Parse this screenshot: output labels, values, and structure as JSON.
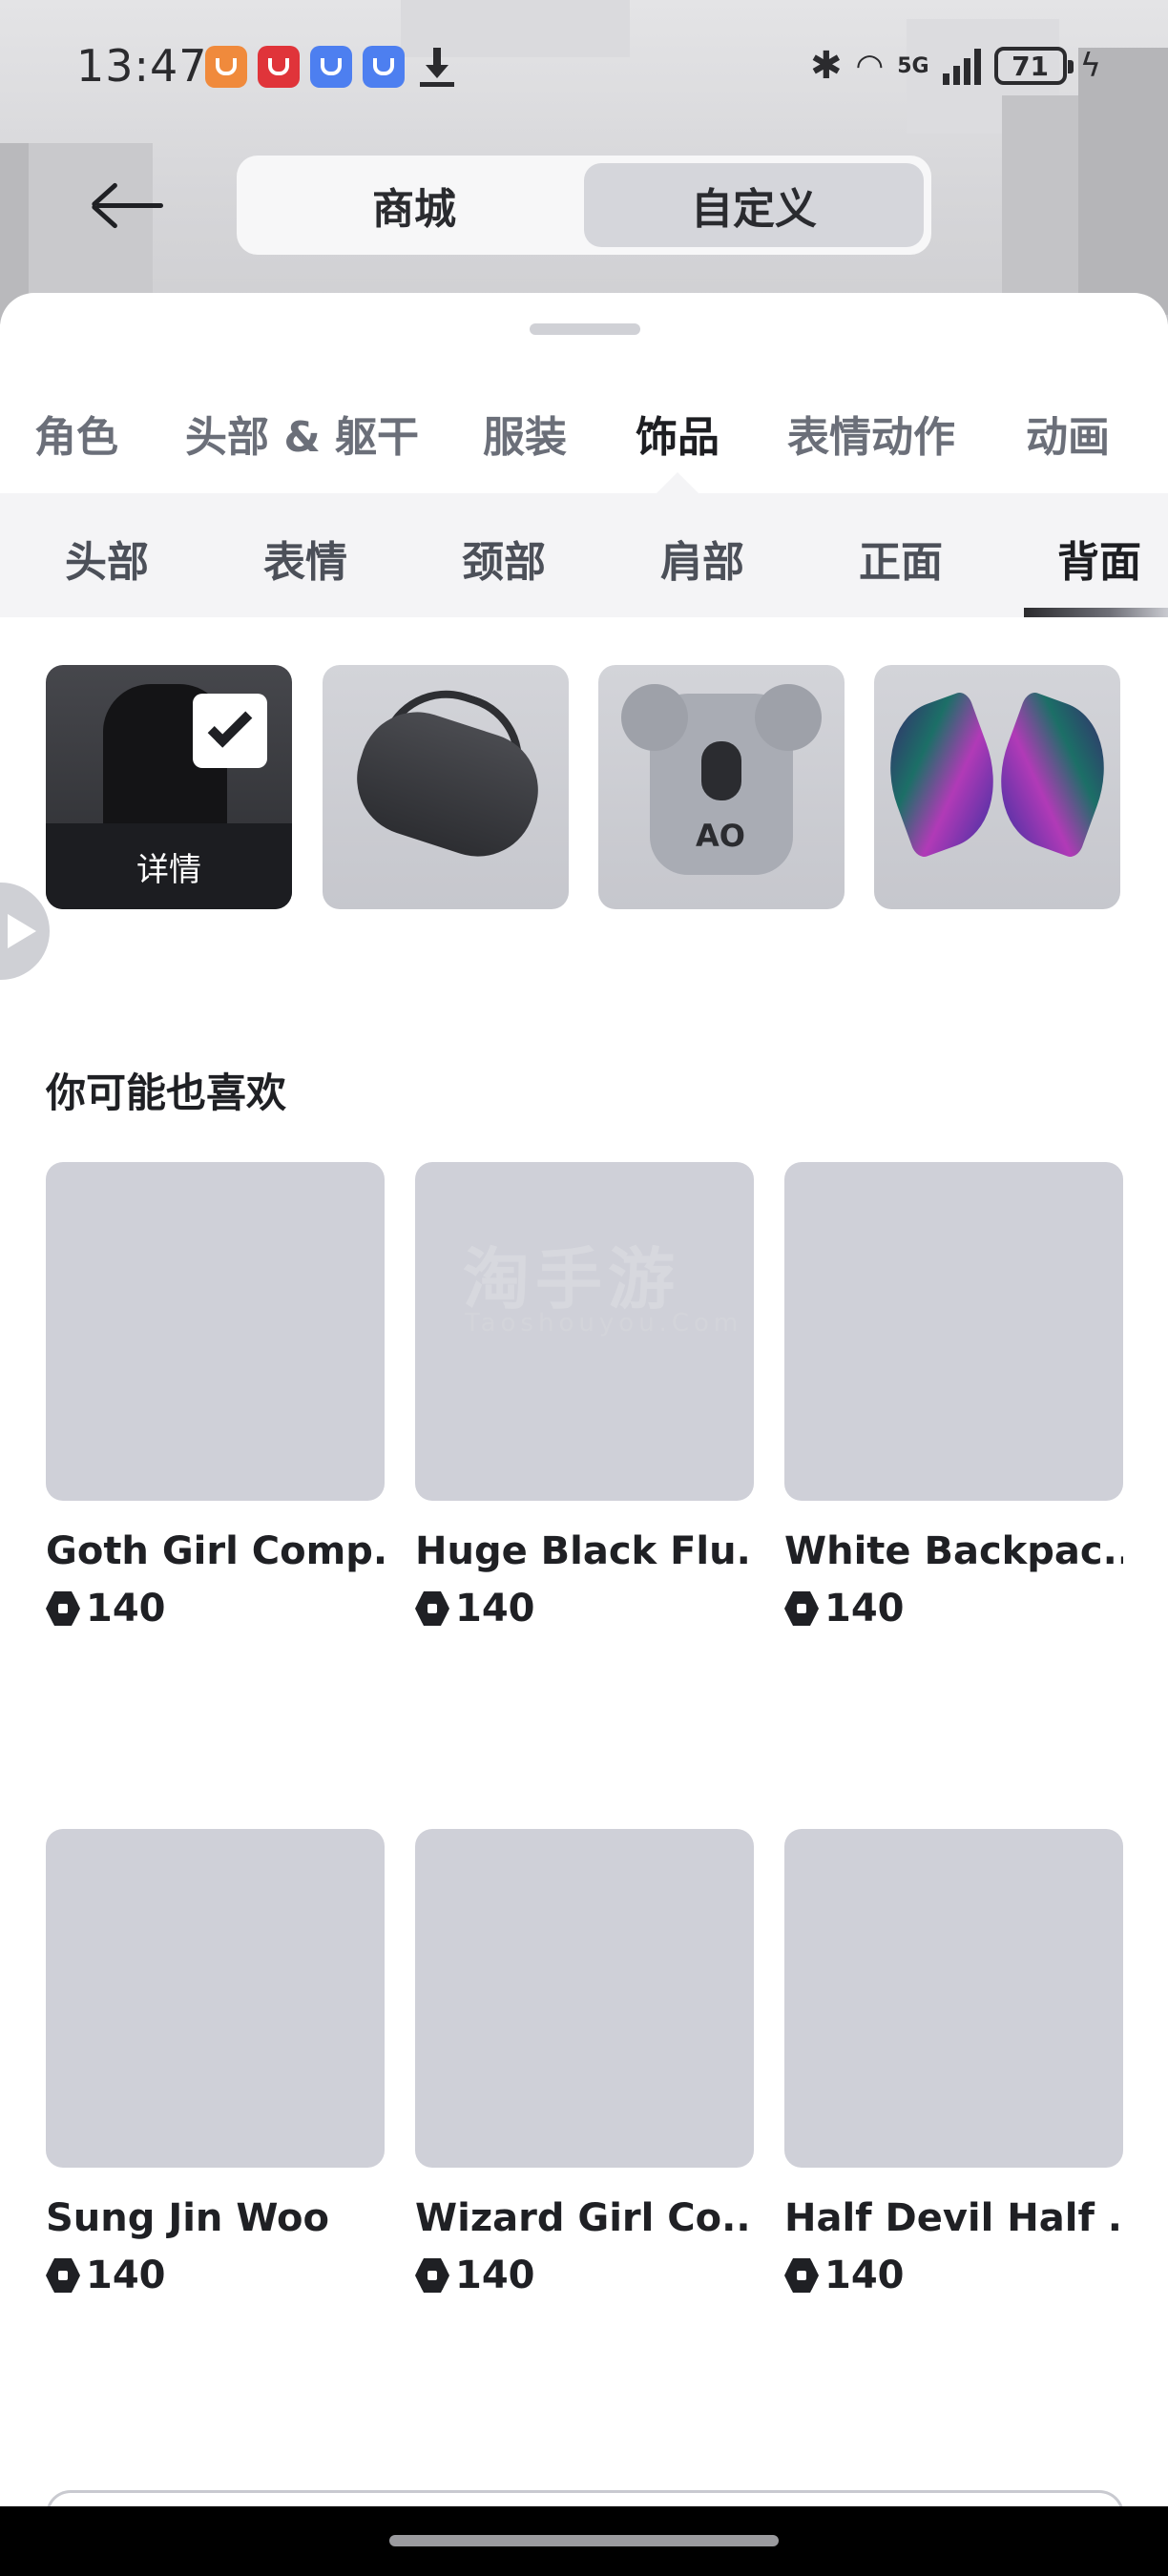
{
  "status_bar": {
    "time": "13:47",
    "battery": "71",
    "network": "5G",
    "icons": [
      "taobao-app-icon",
      "618-app-icon",
      "honor-app-icon",
      "honor-app-icon",
      "download-icon",
      "bluetooth-icon",
      "wifi-icon",
      "signal-icon",
      "charging-icon"
    ]
  },
  "header": {
    "segments": [
      "商城",
      "自定义"
    ],
    "active_segment": "自定义"
  },
  "category_tabs": [
    "角色",
    "头部 & 躯干",
    "服装",
    "饰品",
    "表情动作",
    "动画"
  ],
  "active_category": "饰品",
  "sub_tabs": [
    "头部",
    "表情",
    "颈部",
    "肩部",
    "正面",
    "背面"
  ],
  "active_sub_tab": "背面",
  "equipped": {
    "detail_label": "详情",
    "items": [
      "black-dress",
      "black-duffel-bag",
      "koala-backpack",
      "neon-wings"
    ]
  },
  "recommendations": {
    "title": "你可能也喜欢",
    "items": [
      {
        "name": "Goth Girl Comp...",
        "price": "140"
      },
      {
        "name": "Huge Black Flu...",
        "price": "140"
      },
      {
        "name": "White Backpac...",
        "price": "140"
      },
      {
        "name": "Sung Jin Woo",
        "price": "140"
      },
      {
        "name": "Wizard Girl Co...",
        "price": "140"
      },
      {
        "name": "Half Devil Half ...",
        "price": "140"
      }
    ]
  },
  "watermark": {
    "text": "淘手游",
    "sub": "Taoshouyou.Com"
  }
}
